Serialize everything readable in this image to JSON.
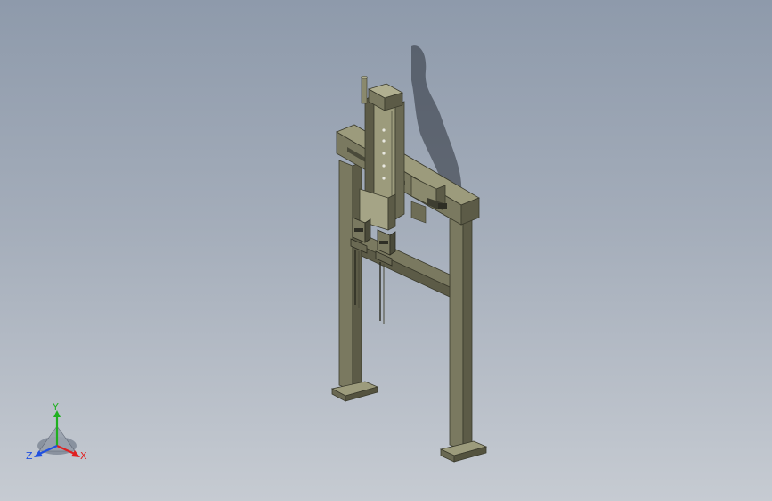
{
  "viewport": {
    "background_top": "#8e9aab",
    "background_bottom": "#c6cbd2",
    "model_color": "#77765c",
    "model_shade": "#5a5946",
    "model_highlight": "#9c9b7c"
  },
  "triad": {
    "x_label": "X",
    "y_label": "Y",
    "z_label": "Z",
    "x_color": "#e02020",
    "y_color": "#20b020",
    "z_color": "#2050e0"
  }
}
